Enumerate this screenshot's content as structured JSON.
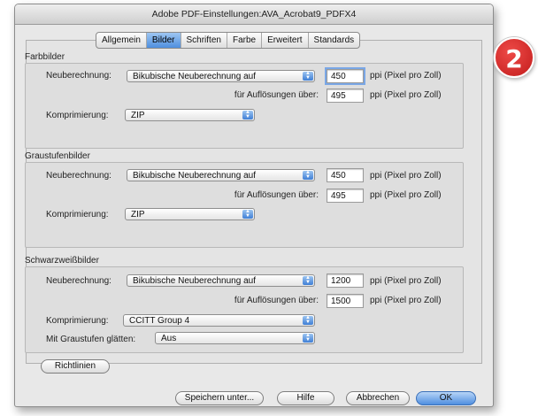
{
  "window": {
    "title": "Adobe PDF-Einstellungen:AVA_Acrobat9_PDFX4"
  },
  "tabs": [
    {
      "label": "Allgemein"
    },
    {
      "label": "Bilder"
    },
    {
      "label": "Schriften"
    },
    {
      "label": "Farbe"
    },
    {
      "label": "Erweitert"
    },
    {
      "label": "Standards"
    }
  ],
  "active_tab": "Bilder",
  "farbbilder": {
    "title": "Farbbilder",
    "neuberechnung_label": "Neuberechnung:",
    "neuberechnung_value": "Bikubische Neuberechnung auf",
    "ppi_value": "450",
    "ppi_unit": "ppi (Pixel pro Zoll)",
    "aufloesung_label": "für Auflösungen über:",
    "aufloesung_value": "495",
    "aufloesung_unit": "ppi (Pixel pro Zoll)",
    "komprimierung_label": "Komprimierung:",
    "komprimierung_value": "ZIP"
  },
  "graustufen": {
    "title": "Graustufenbilder",
    "neuberechnung_label": "Neuberechnung:",
    "neuberechnung_value": "Bikubische Neuberechnung auf",
    "ppi_value": "450",
    "ppi_unit": "ppi (Pixel pro Zoll)",
    "aufloesung_label": "für Auflösungen über:",
    "aufloesung_value": "495",
    "aufloesung_unit": "ppi (Pixel pro Zoll)",
    "komprimierung_label": "Komprimierung:",
    "komprimierung_value": "ZIP"
  },
  "schwarzweiss": {
    "title": "Schwarzweißbilder",
    "neuberechnung_label": "Neuberechnung:",
    "neuberechnung_value": "Bikubische Neuberechnung auf",
    "ppi_value": "1200",
    "ppi_unit": "ppi (Pixel pro Zoll)",
    "aufloesung_label": "für Auflösungen über:",
    "aufloesung_value": "1500",
    "aufloesung_unit": "ppi (Pixel pro Zoll)",
    "komprimierung_label": "Komprimierung:",
    "komprimierung_value": "CCITT Group 4",
    "glaetten_label": "Mit Graustufen glätten:",
    "glaetten_value": "Aus"
  },
  "buttons": {
    "richtlinien": "Richtlinien",
    "speichern": "Speichern unter...",
    "hilfe": "Hilfe",
    "abbrechen": "Abbrechen",
    "ok": "OK"
  },
  "badge": {
    "number": "2",
    "color": "#d42a28"
  },
  "colors": {
    "accent": "#4f8fdf",
    "window_bg": "#e8e8e8"
  }
}
